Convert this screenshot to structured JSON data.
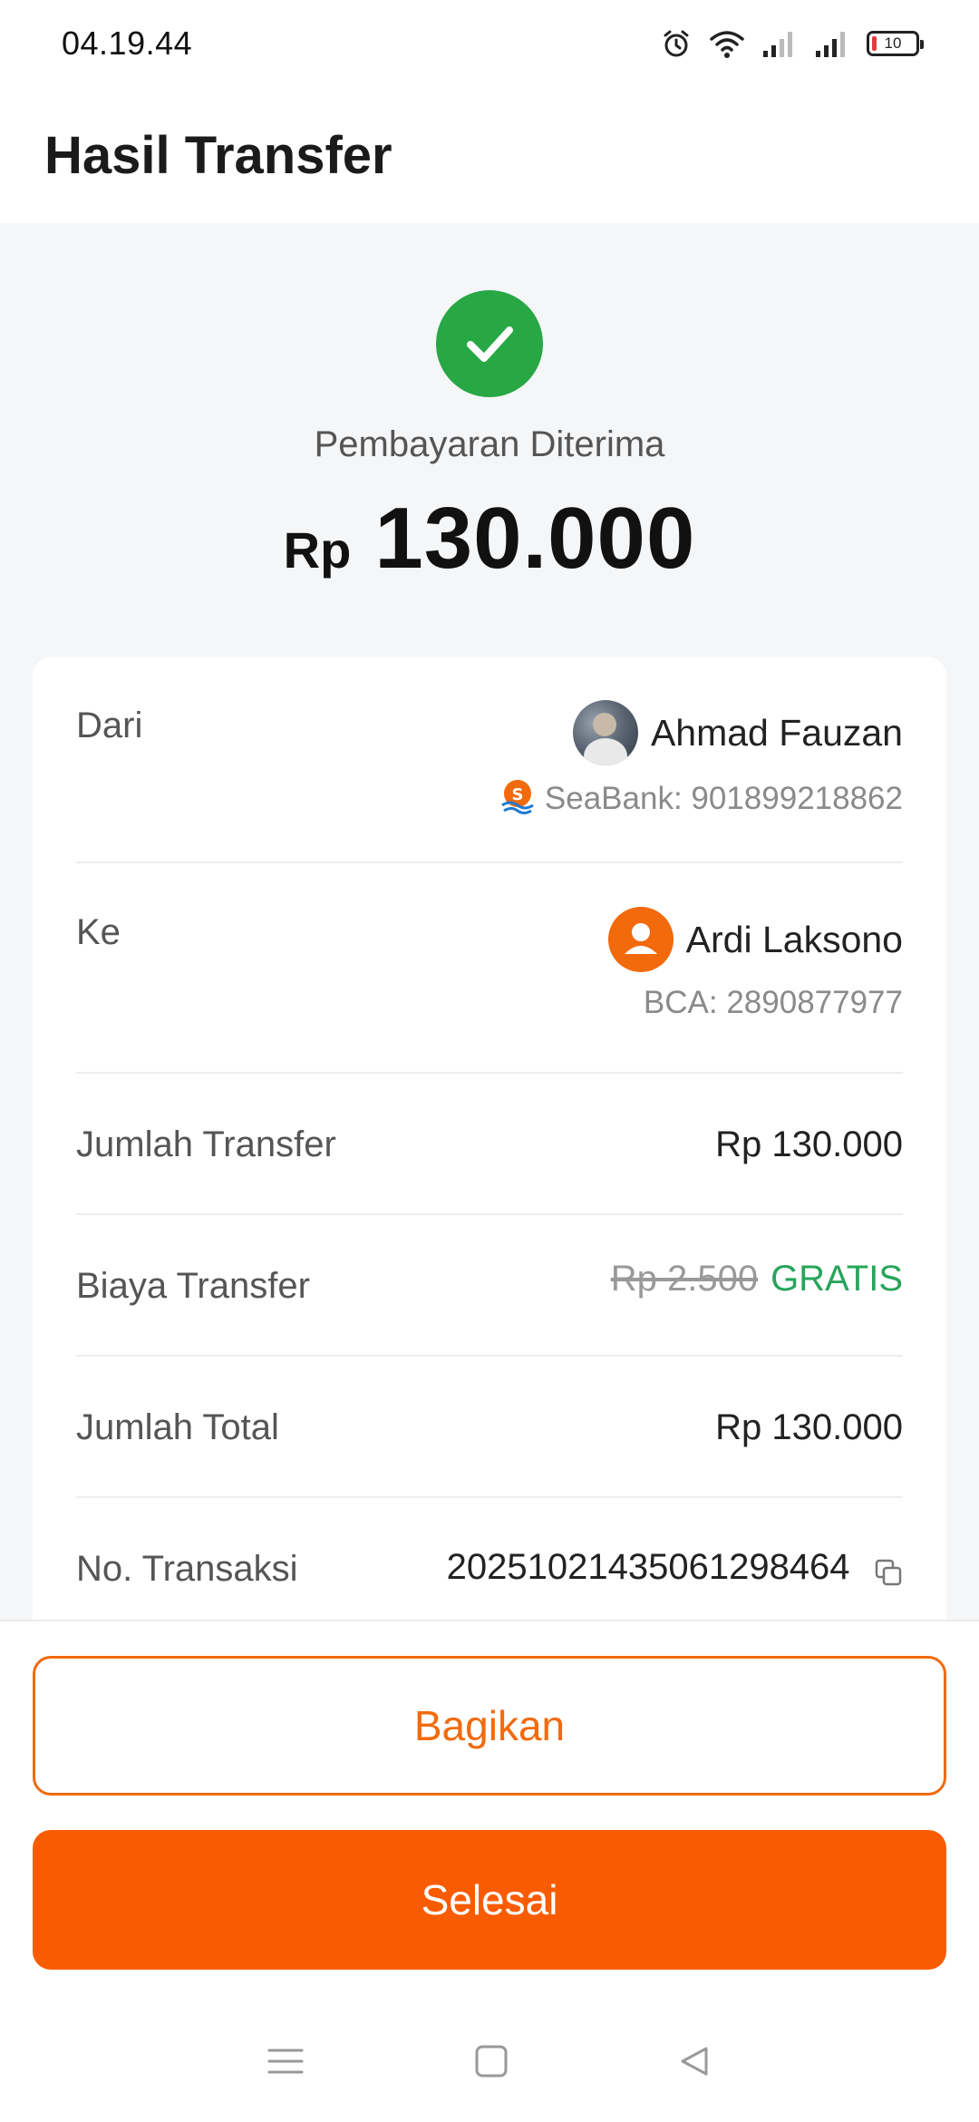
{
  "status_bar": {
    "time": "04.19.44",
    "battery_level": "10",
    "icons": [
      "alarm-icon",
      "wifi-icon",
      "signal-icon",
      "signal-icon",
      "battery-icon"
    ]
  },
  "header": {
    "title": "Hasil Transfer"
  },
  "result": {
    "status": "Pembayaran Diterima",
    "currency": "Rp",
    "amount": "130.000",
    "status_color": "#28a745"
  },
  "details": {
    "from": {
      "label": "Dari",
      "name": "Ahmad Fauzan",
      "account": "SeaBank: 901899218862",
      "bank_icon": "seabank-logo-icon"
    },
    "to": {
      "label": "Ke",
      "name": "Ardi Laksono",
      "account": "BCA: 2890877977",
      "avatar_icon": "person-icon"
    },
    "transfer_amount": {
      "label": "Jumlah Transfer",
      "value": "Rp 130.000"
    },
    "fee": {
      "label": "Biaya Transfer",
      "original": "Rp 2.500",
      "value": "GRATIS",
      "value_color": "#27a55a"
    },
    "total": {
      "label": "Jumlah Total",
      "value": "Rp 130.000"
    },
    "transaction": {
      "label": "No. Transaksi",
      "value": "20251021435061298464"
    }
  },
  "actions": {
    "share_label": "Bagikan",
    "done_label": "Selesai",
    "accent_color": "#f95c00"
  },
  "nav": {
    "icons": [
      "menu-icon",
      "home-icon",
      "back-icon"
    ]
  }
}
